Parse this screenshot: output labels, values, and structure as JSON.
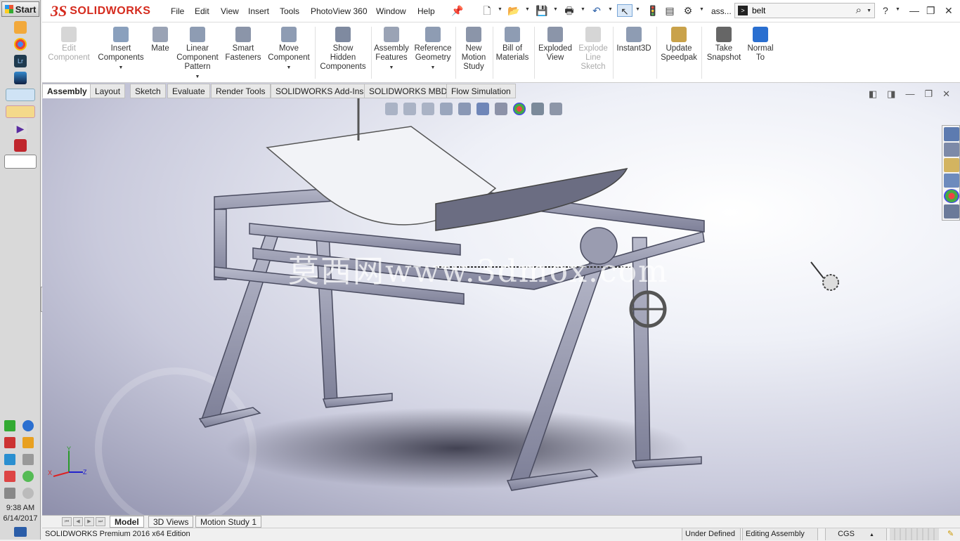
{
  "taskbar": {
    "start_label": "Start",
    "clock_time": "9:38 AM",
    "clock_date": "6/14/2017"
  },
  "app": {
    "logo_ds": "3S",
    "logo_text": "SOLIDWORKS",
    "menu": [
      "File",
      "Edit",
      "View",
      "Insert",
      "Tools",
      "PhotoView 360",
      "Window",
      "Help"
    ],
    "doc_title_short": "ass...",
    "search_value": "belt",
    "help_glyph": "?"
  },
  "ribbon": {
    "tools": [
      {
        "label": "Edit Component",
        "lines": [
          "Edit",
          "Component"
        ],
        "disabled": true
      },
      {
        "label": "Insert Components",
        "lines": [
          "Insert",
          "Components"
        ],
        "disabled": false
      },
      {
        "label": "Mate",
        "lines": [
          "Mate"
        ],
        "disabled": false
      },
      {
        "label": "Linear Component Pattern",
        "lines": [
          "Linear",
          "Component",
          "Pattern"
        ],
        "disabled": false
      },
      {
        "label": "Smart Fasteners",
        "lines": [
          "Smart",
          "Fasteners"
        ],
        "disabled": false
      },
      {
        "label": "Move Component",
        "lines": [
          "Move",
          "Component"
        ],
        "disabled": false
      },
      {
        "label": "Show Hidden Components",
        "lines": [
          "Show",
          "Hidden",
          "Components"
        ],
        "disabled": false
      },
      {
        "label": "Assembly Features",
        "lines": [
          "Assembly",
          "Features"
        ],
        "disabled": false
      },
      {
        "label": "Reference Geometry",
        "lines": [
          "Reference",
          "Geometry"
        ],
        "disabled": false
      },
      {
        "label": "New Motion Study",
        "lines": [
          "New",
          "Motion",
          "Study"
        ],
        "disabled": false
      },
      {
        "label": "Bill of Materials",
        "lines": [
          "Bill of",
          "Materials"
        ],
        "disabled": false
      },
      {
        "label": "Exploded View",
        "lines": [
          "Exploded",
          "View"
        ],
        "disabled": false
      },
      {
        "label": "Explode Line Sketch",
        "lines": [
          "Explode",
          "Line",
          "Sketch"
        ],
        "disabled": true
      },
      {
        "label": "Instant3D",
        "lines": [
          "Instant3D"
        ],
        "disabled": false
      },
      {
        "label": "Update Speedpak",
        "lines": [
          "Update",
          "Speedpak"
        ],
        "disabled": false
      },
      {
        "label": "Take Snapshot",
        "lines": [
          "Take",
          "Snapshot"
        ],
        "disabled": false
      },
      {
        "label": "Normal To",
        "lines": [
          "Normal",
          "To"
        ],
        "disabled": false
      }
    ]
  },
  "tabs": [
    "Assembly",
    "Layout",
    "Sketch",
    "Evaluate",
    "Render Tools",
    "SOLIDWORKS Add-Ins",
    "SOLIDWORKS MBD",
    "Flow Simulation"
  ],
  "graphics": {
    "watermark": "莫西网www.3dmox.com",
    "triad": {
      "x": "X",
      "y": "Y",
      "z": "Z"
    }
  },
  "bottom_tabs": [
    "Model",
    "3D Views",
    "Motion Study 1"
  ],
  "status": {
    "edition": "SOLIDWORKS Premium 2016 x64 Edition",
    "definition": "Under Defined",
    "mode": "Editing Assembly",
    "units": "CGS"
  },
  "colors": {
    "brand_red": "#d52b1e",
    "model_steel": "#8d8fa6",
    "model_light": "#e8e9ef"
  }
}
